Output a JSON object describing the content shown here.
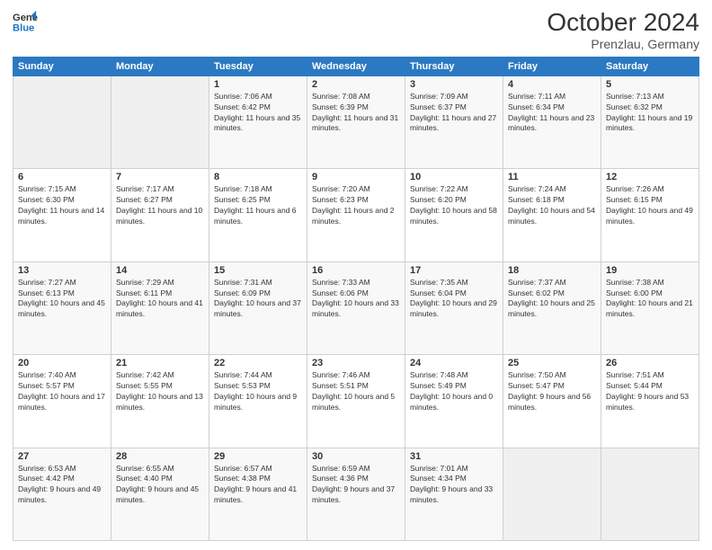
{
  "header": {
    "logo_line1": "General",
    "logo_line2": "Blue",
    "month": "October 2024",
    "location": "Prenzlau, Germany"
  },
  "days_of_week": [
    "Sunday",
    "Monday",
    "Tuesday",
    "Wednesday",
    "Thursday",
    "Friday",
    "Saturday"
  ],
  "weeks": [
    [
      {
        "day": "",
        "sunrise": "",
        "sunset": "",
        "daylight": ""
      },
      {
        "day": "",
        "sunrise": "",
        "sunset": "",
        "daylight": ""
      },
      {
        "day": "1",
        "sunrise": "Sunrise: 7:06 AM",
        "sunset": "Sunset: 6:42 PM",
        "daylight": "Daylight: 11 hours and 35 minutes."
      },
      {
        "day": "2",
        "sunrise": "Sunrise: 7:08 AM",
        "sunset": "Sunset: 6:39 PM",
        "daylight": "Daylight: 11 hours and 31 minutes."
      },
      {
        "day": "3",
        "sunrise": "Sunrise: 7:09 AM",
        "sunset": "Sunset: 6:37 PM",
        "daylight": "Daylight: 11 hours and 27 minutes."
      },
      {
        "day": "4",
        "sunrise": "Sunrise: 7:11 AM",
        "sunset": "Sunset: 6:34 PM",
        "daylight": "Daylight: 11 hours and 23 minutes."
      },
      {
        "day": "5",
        "sunrise": "Sunrise: 7:13 AM",
        "sunset": "Sunset: 6:32 PM",
        "daylight": "Daylight: 11 hours and 19 minutes."
      }
    ],
    [
      {
        "day": "6",
        "sunrise": "Sunrise: 7:15 AM",
        "sunset": "Sunset: 6:30 PM",
        "daylight": "Daylight: 11 hours and 14 minutes."
      },
      {
        "day": "7",
        "sunrise": "Sunrise: 7:17 AM",
        "sunset": "Sunset: 6:27 PM",
        "daylight": "Daylight: 11 hours and 10 minutes."
      },
      {
        "day": "8",
        "sunrise": "Sunrise: 7:18 AM",
        "sunset": "Sunset: 6:25 PM",
        "daylight": "Daylight: 11 hours and 6 minutes."
      },
      {
        "day": "9",
        "sunrise": "Sunrise: 7:20 AM",
        "sunset": "Sunset: 6:23 PM",
        "daylight": "Daylight: 11 hours and 2 minutes."
      },
      {
        "day": "10",
        "sunrise": "Sunrise: 7:22 AM",
        "sunset": "Sunset: 6:20 PM",
        "daylight": "Daylight: 10 hours and 58 minutes."
      },
      {
        "day": "11",
        "sunrise": "Sunrise: 7:24 AM",
        "sunset": "Sunset: 6:18 PM",
        "daylight": "Daylight: 10 hours and 54 minutes."
      },
      {
        "day": "12",
        "sunrise": "Sunrise: 7:26 AM",
        "sunset": "Sunset: 6:15 PM",
        "daylight": "Daylight: 10 hours and 49 minutes."
      }
    ],
    [
      {
        "day": "13",
        "sunrise": "Sunrise: 7:27 AM",
        "sunset": "Sunset: 6:13 PM",
        "daylight": "Daylight: 10 hours and 45 minutes."
      },
      {
        "day": "14",
        "sunrise": "Sunrise: 7:29 AM",
        "sunset": "Sunset: 6:11 PM",
        "daylight": "Daylight: 10 hours and 41 minutes."
      },
      {
        "day": "15",
        "sunrise": "Sunrise: 7:31 AM",
        "sunset": "Sunset: 6:09 PM",
        "daylight": "Daylight: 10 hours and 37 minutes."
      },
      {
        "day": "16",
        "sunrise": "Sunrise: 7:33 AM",
        "sunset": "Sunset: 6:06 PM",
        "daylight": "Daylight: 10 hours and 33 minutes."
      },
      {
        "day": "17",
        "sunrise": "Sunrise: 7:35 AM",
        "sunset": "Sunset: 6:04 PM",
        "daylight": "Daylight: 10 hours and 29 minutes."
      },
      {
        "day": "18",
        "sunrise": "Sunrise: 7:37 AM",
        "sunset": "Sunset: 6:02 PM",
        "daylight": "Daylight: 10 hours and 25 minutes."
      },
      {
        "day": "19",
        "sunrise": "Sunrise: 7:38 AM",
        "sunset": "Sunset: 6:00 PM",
        "daylight": "Daylight: 10 hours and 21 minutes."
      }
    ],
    [
      {
        "day": "20",
        "sunrise": "Sunrise: 7:40 AM",
        "sunset": "Sunset: 5:57 PM",
        "daylight": "Daylight: 10 hours and 17 minutes."
      },
      {
        "day": "21",
        "sunrise": "Sunrise: 7:42 AM",
        "sunset": "Sunset: 5:55 PM",
        "daylight": "Daylight: 10 hours and 13 minutes."
      },
      {
        "day": "22",
        "sunrise": "Sunrise: 7:44 AM",
        "sunset": "Sunset: 5:53 PM",
        "daylight": "Daylight: 10 hours and 9 minutes."
      },
      {
        "day": "23",
        "sunrise": "Sunrise: 7:46 AM",
        "sunset": "Sunset: 5:51 PM",
        "daylight": "Daylight: 10 hours and 5 minutes."
      },
      {
        "day": "24",
        "sunrise": "Sunrise: 7:48 AM",
        "sunset": "Sunset: 5:49 PM",
        "daylight": "Daylight: 10 hours and 0 minutes."
      },
      {
        "day": "25",
        "sunrise": "Sunrise: 7:50 AM",
        "sunset": "Sunset: 5:47 PM",
        "daylight": "Daylight: 9 hours and 56 minutes."
      },
      {
        "day": "26",
        "sunrise": "Sunrise: 7:51 AM",
        "sunset": "Sunset: 5:44 PM",
        "daylight": "Daylight: 9 hours and 53 minutes."
      }
    ],
    [
      {
        "day": "27",
        "sunrise": "Sunrise: 6:53 AM",
        "sunset": "Sunset: 4:42 PM",
        "daylight": "Daylight: 9 hours and 49 minutes."
      },
      {
        "day": "28",
        "sunrise": "Sunrise: 6:55 AM",
        "sunset": "Sunset: 4:40 PM",
        "daylight": "Daylight: 9 hours and 45 minutes."
      },
      {
        "day": "29",
        "sunrise": "Sunrise: 6:57 AM",
        "sunset": "Sunset: 4:38 PM",
        "daylight": "Daylight: 9 hours and 41 minutes."
      },
      {
        "day": "30",
        "sunrise": "Sunrise: 6:59 AM",
        "sunset": "Sunset: 4:36 PM",
        "daylight": "Daylight: 9 hours and 37 minutes."
      },
      {
        "day": "31",
        "sunrise": "Sunrise: 7:01 AM",
        "sunset": "Sunset: 4:34 PM",
        "daylight": "Daylight: 9 hours and 33 minutes."
      },
      {
        "day": "",
        "sunrise": "",
        "sunset": "",
        "daylight": ""
      },
      {
        "day": "",
        "sunrise": "",
        "sunset": "",
        "daylight": ""
      }
    ]
  ]
}
